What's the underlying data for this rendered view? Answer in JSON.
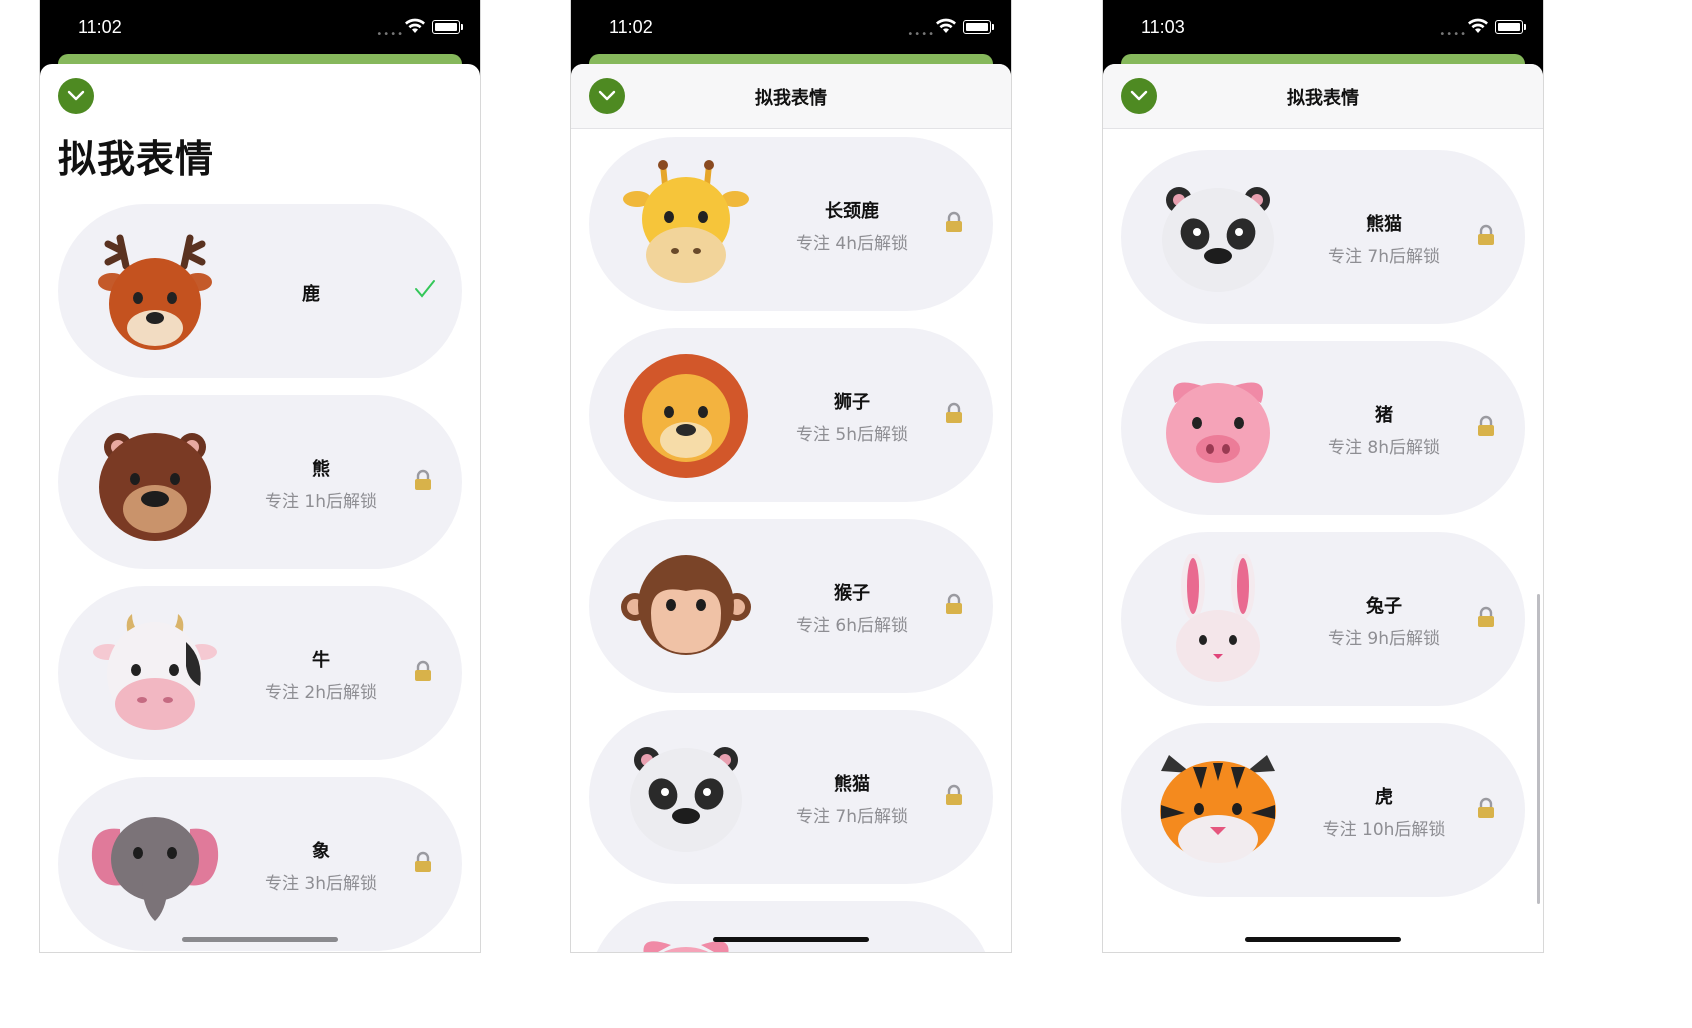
{
  "colors": {
    "accent_green": "#4e8a22",
    "bar_green": "#86b85c",
    "card_bg": "#f1f1f6",
    "check_green": "#34c759",
    "subtitle_grey": "#8e8e93"
  },
  "screens": [
    {
      "time": "11:02",
      "title": "拟我表情",
      "cards": [
        {
          "name": "鹿",
          "status": "selected",
          "icon": "deer-icon"
        },
        {
          "name": "熊",
          "sub": "专注 1h后解锁",
          "status": "locked",
          "icon": "bear-icon"
        },
        {
          "name": "牛",
          "sub": "专注 2h后解锁",
          "status": "locked",
          "icon": "cow-icon"
        },
        {
          "name": "象",
          "sub": "专注 3h后解锁",
          "status": "locked",
          "icon": "elephant-icon"
        }
      ]
    },
    {
      "time": "11:02",
      "title": "拟我表情",
      "cards": [
        {
          "name": "长颈鹿",
          "sub": "专注 4h后解锁",
          "status": "locked",
          "icon": "giraffe-icon"
        },
        {
          "name": "狮子",
          "sub": "专注 5h后解锁",
          "status": "locked",
          "icon": "lion-icon"
        },
        {
          "name": "猴子",
          "sub": "专注 6h后解锁",
          "status": "locked",
          "icon": "monkey-icon"
        },
        {
          "name": "熊猫",
          "sub": "专注 7h后解锁",
          "status": "locked",
          "icon": "panda-icon"
        }
      ]
    },
    {
      "time": "11:03",
      "title": "拟我表情",
      "cards": [
        {
          "name": "熊猫",
          "sub": "专注 7h后解锁",
          "status": "locked",
          "icon": "panda-icon"
        },
        {
          "name": "猪",
          "sub": "专注 8h后解锁",
          "status": "locked",
          "icon": "pig-icon"
        },
        {
          "name": "兔子",
          "sub": "专注 9h后解锁",
          "status": "locked",
          "icon": "rabbit-icon"
        },
        {
          "name": "虎",
          "sub": "专注 10h后解锁",
          "status": "locked",
          "icon": "tiger-icon"
        }
      ]
    }
  ]
}
